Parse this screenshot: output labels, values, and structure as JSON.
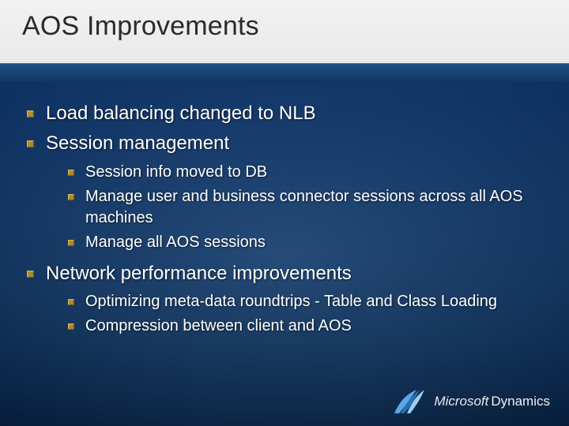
{
  "title": "AOS Improvements",
  "bullets": [
    {
      "text": "Load balancing changed to NLB"
    },
    {
      "text": "Session management",
      "children": [
        "Session info moved to DB",
        "Manage user and business connector sessions across all AOS machines",
        "Manage all AOS sessions"
      ]
    },
    {
      "text": "Network performance improvements",
      "children": [
        "Optimizing meta-data roundtrips - Table and Class Loading",
        "Compression between client and AOS"
      ]
    }
  ],
  "footer": {
    "brand1": "Microsoft",
    "brand2": "Dynamics"
  }
}
